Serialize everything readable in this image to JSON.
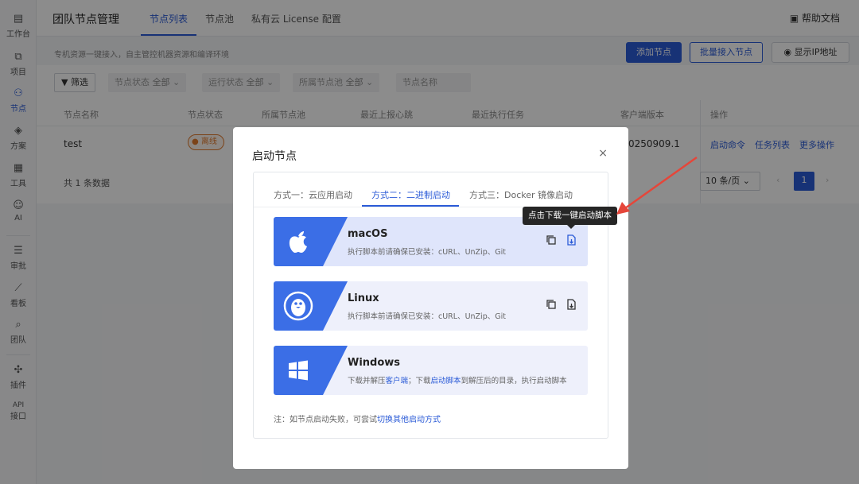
{
  "sidebar": {
    "items": [
      {
        "label": "工作台",
        "icon": "dashboard-icon"
      },
      {
        "label": "项目",
        "icon": "project-icon"
      },
      {
        "label": "节点",
        "icon": "node-icon",
        "active": true
      },
      {
        "label": "方案",
        "icon": "layers-icon"
      },
      {
        "label": "工具",
        "icon": "grid-icon"
      },
      {
        "label": "AI",
        "icon": "robot-icon"
      },
      {
        "label": "审批",
        "icon": "approval-icon"
      },
      {
        "label": "看板",
        "icon": "chart-icon"
      },
      {
        "label": "团队",
        "icon": "team-icon"
      },
      {
        "label": "插件",
        "icon": "plugin-icon"
      },
      {
        "label": "API",
        "icon": "api-label"
      },
      {
        "label": "接口",
        "icon": ""
      }
    ]
  },
  "header": {
    "title": "团队节点管理",
    "tabs": [
      "节点列表",
      "节点池",
      "私有云 License 配置"
    ],
    "help": "帮助文档"
  },
  "toolbar": {
    "description": "专机资源一键接入，自主管控机器资源和编译环境",
    "add_node": "添加节点",
    "batch_add": "批量接入节点",
    "show_ip": "显示IP地址"
  },
  "filters": {
    "filter_btn": "筛选",
    "items": [
      {
        "label": "节点状态",
        "value": "全部"
      },
      {
        "label": "运行状态",
        "value": "全部"
      },
      {
        "label": "所属节点池",
        "value": "全部"
      }
    ],
    "name_placeholder": "节点名称"
  },
  "table": {
    "headers": [
      "节点名称",
      "节点状态",
      "所属节点池",
      "最近上报心跳",
      "最近执行任务",
      "客户端版本",
      "操作"
    ],
    "rows": [
      {
        "name": "test",
        "status": "离线",
        "version": "0250909.1",
        "ops": [
          "启动命令",
          "任务列表",
          "更多操作"
        ]
      }
    ],
    "total": "共 1 条数据",
    "page_size": "10 条/页",
    "current_page": "1"
  },
  "modal": {
    "title": "启动节点",
    "close": "×",
    "tabs": [
      "方式一：云应用启动",
      "方式二：二进制启动",
      "方式三：Docker 镜像启动"
    ],
    "active_tab": 1,
    "cards": [
      {
        "name": "macOS",
        "desc": "执行脚本前请确保已安装：cURL、UnZip、Git",
        "icon": "apple-icon"
      },
      {
        "name": "Linux",
        "desc": "执行脚本前请确保已安装：cURL、UnZip、Git",
        "icon": "linux-penguin-icon"
      },
      {
        "name": "Windows",
        "desc_parts": [
          "下载并解压",
          "客户端",
          "；下载",
          "启动脚本",
          "到解压后的目录，执行启动脚本"
        ],
        "icon": "windows-icon"
      }
    ],
    "note_prefix": "注：如节点启动失败，可尝试",
    "note_link": "切换其他启动方式"
  },
  "tooltip": "点击下载一键启动脚本",
  "colors": {
    "accent": "#2b5bd7",
    "annotation_arrow": "#e5463a",
    "offline": "#e07b2e"
  }
}
